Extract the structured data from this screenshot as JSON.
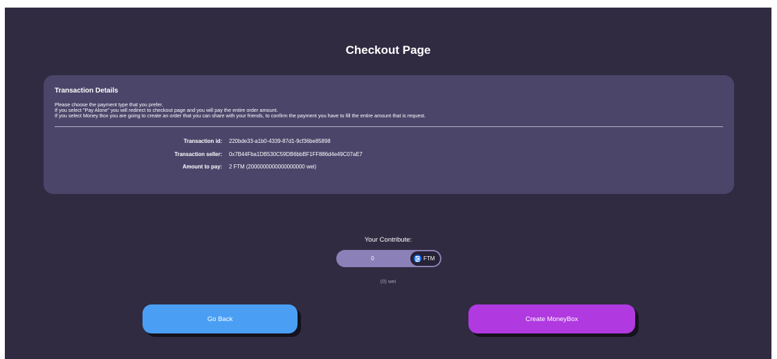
{
  "page": {
    "title": "Checkout Page"
  },
  "transaction": {
    "title": "Transaction Details",
    "description": [
      "Please choose the payment type that you prefer.",
      "If you select \"Pay Alone\" you will redirect to checkout page and you will pay the entire order amount.",
      "If you select Money Box you are going to create an order that you can share with your friends, to confirm the payment you have to fill the entire amount that is request."
    ],
    "details": [
      {
        "label": "Transaction id:",
        "value": "220bde33-a1b0-4339-87d1-9cf36be85898"
      },
      {
        "label": "Transaction seller:",
        "value": "0x7B44Fba1DB530C59DB6bbBF1FF886d4e49C07aE7"
      },
      {
        "label": "Amount to pay:",
        "value": "2 FTM (2000000000000000000 wei)"
      }
    ]
  },
  "contribute": {
    "label": "Your Contribute:",
    "value": "0",
    "token": "FTM",
    "token_icon": "fantom-icon",
    "wei_text": "(0) wei"
  },
  "actions": {
    "back_label": "Go Back",
    "create_label": "Create MoneyBox"
  },
  "colors": {
    "background": "#302b41",
    "card": "#4c456a",
    "back_button": "#4a9ff5",
    "create_button": "#b03ae0",
    "input": "#8c80b8"
  }
}
